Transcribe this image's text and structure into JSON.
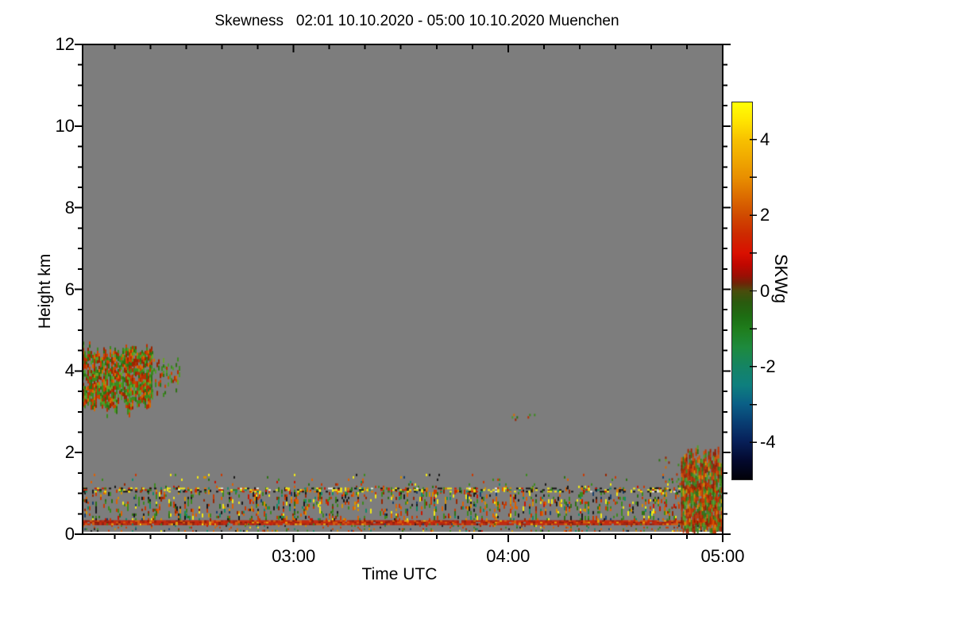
{
  "title": "Skewness   02:01 10.10.2020 - 05:00 10.10.2020 Muenchen",
  "chart_data": {
    "type": "heatmap",
    "title": "Skewness   02:01 10.10.2020 - 05:00 10.10.2020 Muenchen",
    "instrument_quantity": "Skewness",
    "time_start": "02:01",
    "time_end": "05:00",
    "date": "10.10.2020",
    "location": "Muenchen",
    "xlabel": "Time UTC",
    "ylabel": "Height km",
    "x_range_minutes": [
      121,
      300
    ],
    "x_major_ticks": [
      {
        "minute": 180,
        "label": "03:00"
      },
      {
        "minute": 240,
        "label": "04:00"
      },
      {
        "minute": 300,
        "label": "05:00"
      }
    ],
    "x_minor_step_minutes": 10,
    "ylim": [
      0,
      12
    ],
    "y_major_ticks": [
      0,
      2,
      4,
      6,
      8,
      10,
      12
    ],
    "y_minor_step": 0.5,
    "grid": false,
    "background_color": "#ffffff",
    "no_data_color": "#7d7d7d",
    "frame_color": "#000000",
    "seed": 1337,
    "colorbar": {
      "label": "SKWg",
      "min": -5,
      "max": 5,
      "tick_step": 1,
      "label_ticks": [
        {
          "value": 4,
          "label": "4"
        },
        {
          "value": 2,
          "label": "2"
        },
        {
          "value": 0,
          "label": "0"
        },
        {
          "value": -2,
          "label": "-2"
        },
        {
          "value": -4,
          "label": "-4"
        }
      ],
      "gradient": [
        [
          5,
          "#ffff06"
        ],
        [
          4.5,
          "#ffe400"
        ],
        [
          4,
          "#f7c000"
        ],
        [
          3.5,
          "#f0a800"
        ],
        [
          3,
          "#e88e00"
        ],
        [
          2.5,
          "#dc6c00"
        ],
        [
          2,
          "#d04a00"
        ],
        [
          1.5,
          "#cd2a00"
        ],
        [
          1,
          "#d91000"
        ],
        [
          0.7,
          "#c00700"
        ],
        [
          0.4,
          "#9a0f04"
        ],
        [
          0.2,
          "#6f2407"
        ],
        [
          0,
          "#4a4c0c"
        ],
        [
          -0.3,
          "#2a5a0e"
        ],
        [
          -0.7,
          "#1d6e13"
        ],
        [
          -1,
          "#1f7d1c"
        ],
        [
          -1.5,
          "#1e8a3e"
        ],
        [
          -2,
          "#158463"
        ],
        [
          -2.5,
          "#0e7f7e"
        ],
        [
          -3,
          "#0a5f86"
        ],
        [
          -3.5,
          "#083d72"
        ],
        [
          -4,
          "#071f58"
        ],
        [
          -4.5,
          "#03092e"
        ],
        [
          -5,
          "#010108"
        ]
      ]
    },
    "palettes": {
      "cloud": {
        "colors": [
          "#b82f00",
          "#cc4400",
          "#992600",
          "#d86a00",
          "#3c8a1e",
          "#2e7314",
          "#4f9e28",
          "#6aa526"
        ],
        "weights": [
          0.16,
          0.12,
          0.12,
          0.08,
          0.2,
          0.14,
          0.12,
          0.06
        ]
      },
      "rain": {
        "colors": [
          "#c43400",
          "#a82600",
          "#d85200",
          "#8f1c00",
          "#3c8a1e",
          "#2e7314",
          "#54a02a",
          "#d89000"
        ],
        "weights": [
          0.2,
          0.14,
          0.12,
          0.1,
          0.16,
          0.12,
          0.1,
          0.06
        ]
      },
      "band": {
        "colors": [
          "#cc3a00",
          "#e06000",
          "#992600",
          "#3c8a1e",
          "#2e7314",
          "#128c6a",
          "#f2ea14",
          "#1a1a1a",
          "#d89000",
          "#17406e",
          "#cc1500"
        ],
        "weights": [
          0.13,
          0.1,
          0.08,
          0.17,
          0.1,
          0.07,
          0.08,
          0.1,
          0.08,
          0.04,
          0.05
        ]
      },
      "dash": {
        "colors": [
          "#f2ea14",
          "#151515",
          "#cc2000",
          "#e07800",
          "#e8e8e8",
          "#128c6a",
          "#2e7d1e"
        ],
        "weights": [
          0.3,
          0.28,
          0.14,
          0.12,
          0.05,
          0.05,
          0.06
        ]
      },
      "redline": {
        "colors": [
          "#cc1f00",
          "#a81800",
          "#e05500",
          "#8f1200",
          "#f2a000"
        ],
        "weights": [
          0.45,
          0.2,
          0.2,
          0.1,
          0.05
        ]
      }
    },
    "features": [
      {
        "name": "upper-speckle",
        "type": "speckle",
        "x": [
          0.0,
          1.0
        ],
        "km": [
          1.15,
          1.48
        ],
        "density": 0.045,
        "cell": [
          2,
          3
        ],
        "palette": "band",
        "col_var": true
      },
      {
        "name": "band-speckle",
        "type": "speckle",
        "x": [
          0.0,
          1.0
        ],
        "km": [
          0.34,
          1.15
        ],
        "density": 0.16,
        "cell": [
          2,
          3
        ],
        "palette": "band",
        "col_var": true,
        "streak": true
      },
      {
        "name": "dash-line-1p1km",
        "type": "speckle",
        "x": [
          0.0,
          1.0
        ],
        "km": [
          1.06,
          1.14
        ],
        "density": 0.38,
        "cell": [
          3,
          2
        ],
        "palette": "dash",
        "col_var": true
      },
      {
        "name": "red-line-0p3km",
        "type": "speckle",
        "x": [
          0.0,
          1.0
        ],
        "km": [
          0.26,
          0.34
        ],
        "density": 0.97,
        "cell": [
          3,
          2
        ],
        "palette": "redline",
        "col_var": false
      },
      {
        "name": "low-speckle",
        "type": "speckle",
        "x": [
          0.0,
          1.0
        ],
        "km": [
          0.06,
          0.26
        ],
        "density": 0.1,
        "cell": [
          2,
          2
        ],
        "palette": "band",
        "col_var": true
      },
      {
        "name": "cloud-left",
        "type": "blob",
        "x": [
          0.0,
          0.108
        ],
        "top_km": [
          4.35,
          4.68
        ],
        "bot_km": [
          2.9,
          3.4
        ],
        "density": 0.82,
        "cell": [
          2,
          4
        ],
        "palette": "cloud"
      },
      {
        "name": "cloud-left-fragments",
        "type": "blob",
        "x": [
          0.108,
          0.152
        ],
        "top_km": [
          4.1,
          4.45
        ],
        "bot_km": [
          3.3,
          3.9
        ],
        "density": 0.3,
        "cell": [
          2,
          4
        ],
        "palette": "cloud"
      },
      {
        "name": "mid-specks-2p9km",
        "type": "speckle",
        "x": [
          0.648,
          0.707
        ],
        "km": [
          2.82,
          2.95
        ],
        "density": 0.07,
        "cell": [
          2,
          3
        ],
        "palette": "cloud",
        "col_var": true
      },
      {
        "name": "rain-fringe",
        "type": "speckle",
        "x": [
          0.9,
          0.935
        ],
        "km": [
          0.3,
          1.9
        ],
        "density": 0.08,
        "cell": [
          2,
          3
        ],
        "palette": "cloud",
        "col_var": true
      },
      {
        "name": "rain-column-right",
        "type": "blob",
        "x": [
          0.935,
          1.0
        ],
        "top_km": [
          1.75,
          2.18
        ],
        "bot_km": [
          0.08,
          0.18
        ],
        "density": 0.9,
        "cell": [
          2,
          5
        ],
        "palette": "rain"
      }
    ]
  }
}
